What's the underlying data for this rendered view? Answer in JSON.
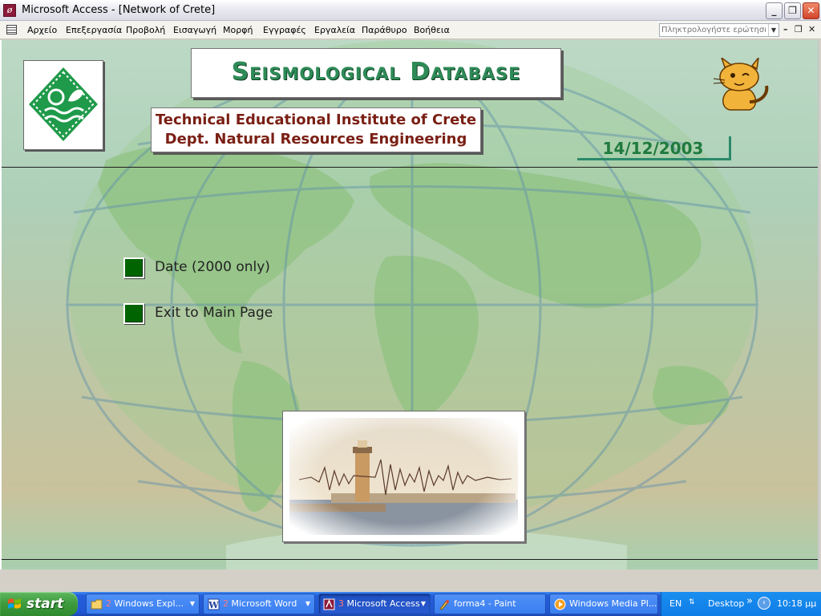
{
  "window": {
    "title": "Microsoft Access - [Network of Crete]",
    "controls": {
      "minimize": "_",
      "restore": "❐",
      "close": "✕"
    }
  },
  "menubar": {
    "items": [
      "Αρχείο",
      "Επεξεργασία",
      "Προβολή",
      "Εισαγωγή",
      "Μορφή",
      "Εγγραφές",
      "Εργαλεία",
      "Παράθυρο",
      "Βοήθεια"
    ],
    "help_placeholder": "Πληκτρολογήστε ερώτηση",
    "mdi_controls": {
      "minimize": "–",
      "restore": "❐",
      "close": "✕"
    }
  },
  "form": {
    "title": "Seismological Database",
    "institute_line1": "Technical Educational Institute of Crete",
    "institute_line2": "Dept. Natural Resources Engineering",
    "date": "14/12/2003",
    "buttons": [
      {
        "label": "Date (2000 only)"
      },
      {
        "label": "Exit to Main Page"
      }
    ],
    "colors": {
      "title": "#2e8b57",
      "institute": "#7a1f14",
      "button": "#006400",
      "date": "#1f7a3e"
    }
  },
  "taskbar": {
    "start_label": "start",
    "tasks": [
      {
        "count": "2",
        "label": "Windows Expl...",
        "icon": "folder-icon"
      },
      {
        "count": "2",
        "label": "Microsoft Word",
        "icon": "word-icon"
      },
      {
        "count": "3",
        "label": "Microsoft Access",
        "icon": "access-icon",
        "active": true
      },
      {
        "count": "",
        "label": "forma4 - Paint",
        "icon": "paint-icon"
      },
      {
        "count": "",
        "label": "Windows Media Pl...",
        "icon": "media-player-icon"
      }
    ],
    "tray": {
      "language": "EN",
      "desktop": "Desktop",
      "chevron": "»",
      "clock": "10:18 μμ"
    }
  }
}
